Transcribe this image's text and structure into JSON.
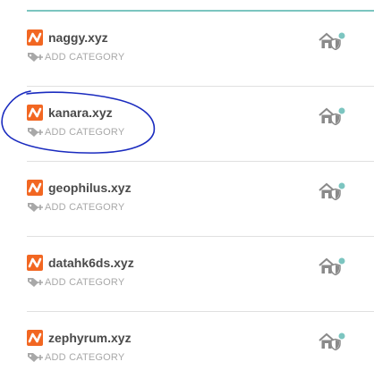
{
  "domains": [
    {
      "name": "naggy.xyz",
      "add_category": "ADD CATEGORY"
    },
    {
      "name": "kanara.xyz",
      "add_category": "ADD CATEGORY"
    },
    {
      "name": "geophilus.xyz",
      "add_category": "ADD CATEGORY"
    },
    {
      "name": "datahk6ds.xyz",
      "add_category": "ADD CATEGORY"
    },
    {
      "name": "zephyrum.xyz",
      "add_category": "ADD CATEGORY"
    }
  ],
  "icons": {
    "brand": "namecheap-logo-icon",
    "add_category": "tag-plus-icon",
    "status": "home-shield-icon"
  },
  "colors": {
    "brand_orange": "#f26722",
    "accent_teal": "#7cc5c0",
    "annotation_blue": "#1a2bbf"
  }
}
